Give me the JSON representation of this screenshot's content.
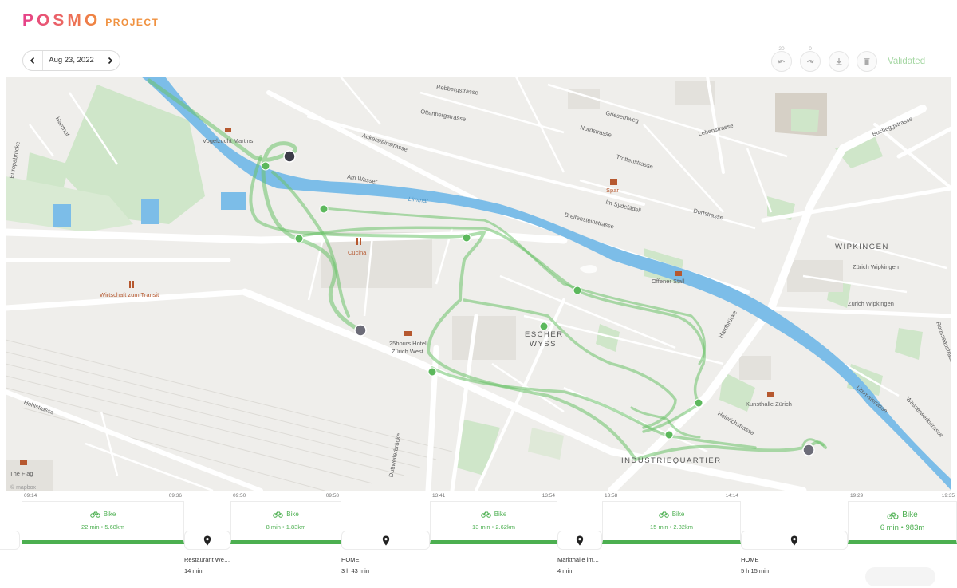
{
  "app": {
    "logo_main": "POSMO",
    "logo_sub": "PROJECT"
  },
  "toolbar": {
    "date": "Aug 23, 2022",
    "undo_count": "20",
    "redo_count": "0",
    "status": "Validated"
  },
  "map": {
    "labels": {
      "vogelzucht": "Vogelzucht Martins",
      "cucina": "Cucina",
      "wirtschaft": "Wirtschaft zum Transit",
      "hotel_1": "25hours Hotel",
      "hotel_2": "Zürich West",
      "escher_1": "ESCHER",
      "escher_2": "WYSS",
      "industriequartier": "INDUSTRIEQUARTIER",
      "wipkingen": "WIPKINGEN",
      "zurich_wipkingen_1": "Zürich Wipkingen",
      "zurich_wipkingen_2": "Zürich Wipkingen",
      "spar": "Spar",
      "offener_stall": "Offener Stall",
      "kunsthalle": "Kunsthalle Zürich",
      "the_flag": "The Flag",
      "limmat": "Limmat",
      "am_wasser": "Am Wasser",
      "rebbergstrasse": "Rebbergstrasse",
      "ottenbergstrasse": "Ottenbergstrasse",
      "ackersteinstrasse": "Ackersteinstrasse",
      "griesernweg": "Griesernweg",
      "nordstrasse": "Nordstrasse",
      "trottenstrasse": "Trottenstrasse",
      "lehenstrasse": "Lehenstrasse",
      "buchegg": "Bucheggstrasse",
      "breitenstein": "Breitensteinstrasse",
      "im_sydefadeli": "Im Sydefädeli",
      "dorfstrasse": "Dorfstrasse",
      "hardbrucke": "Hardbrücke",
      "hardturm": "Hardhof",
      "europabrucke": "Europabrücke",
      "hohlstrasse": "Hohlstrasse",
      "duttweiler": "Duttweilerbrücke",
      "wasserwerk": "Wasserwerkstrasse",
      "rousseau": "Rousseaustrasse",
      "limmatstrasse": "Limmatstrasse",
      "heinrich": "Heinrichstrasse",
      "attribution": "© mapbox"
    }
  },
  "timeline": {
    "trips": [
      {
        "start": "09:14",
        "end": "09:36",
        "mode": "Bike",
        "stats": "22 min • 5.68km"
      },
      {
        "start": "09:50",
        "end": "09:58",
        "mode": "Bike",
        "stats": "8 min • 1.83km"
      },
      {
        "start": "13:41",
        "end": "13:54",
        "mode": "Bike",
        "stats": "13 min • 2.62km"
      },
      {
        "start": "13:58",
        "end": "14:14",
        "mode": "Bike",
        "stats": "15 min • 2.82km"
      },
      {
        "start": "19:29",
        "end": "19:35",
        "mode": "Bike",
        "stats": "6 min • 983m"
      }
    ],
    "stops": [
      {
        "name": "Restaurant We…",
        "duration": "14 min"
      },
      {
        "name": "HOME",
        "duration": "3 h 43 min"
      },
      {
        "name": "Markthalle im…",
        "duration": "4 min"
      },
      {
        "name": "HOME",
        "duration": "5 h 15 min"
      }
    ]
  },
  "colors": {
    "accent_green": "#4caf50",
    "route_green": "#6cc36a",
    "river_blue": "#7cbde8",
    "park_green": "#c6e3bf",
    "map_bg": "#efeeeb",
    "validated": "#a7d8a5"
  },
  "icons": {
    "prev": "chevron-left-icon",
    "next": "chevron-right-icon",
    "undo": "undo-icon",
    "redo": "redo-icon",
    "download": "download-icon",
    "delete": "trash-icon",
    "bike": "bike-icon",
    "stop": "map-pin-icon"
  }
}
